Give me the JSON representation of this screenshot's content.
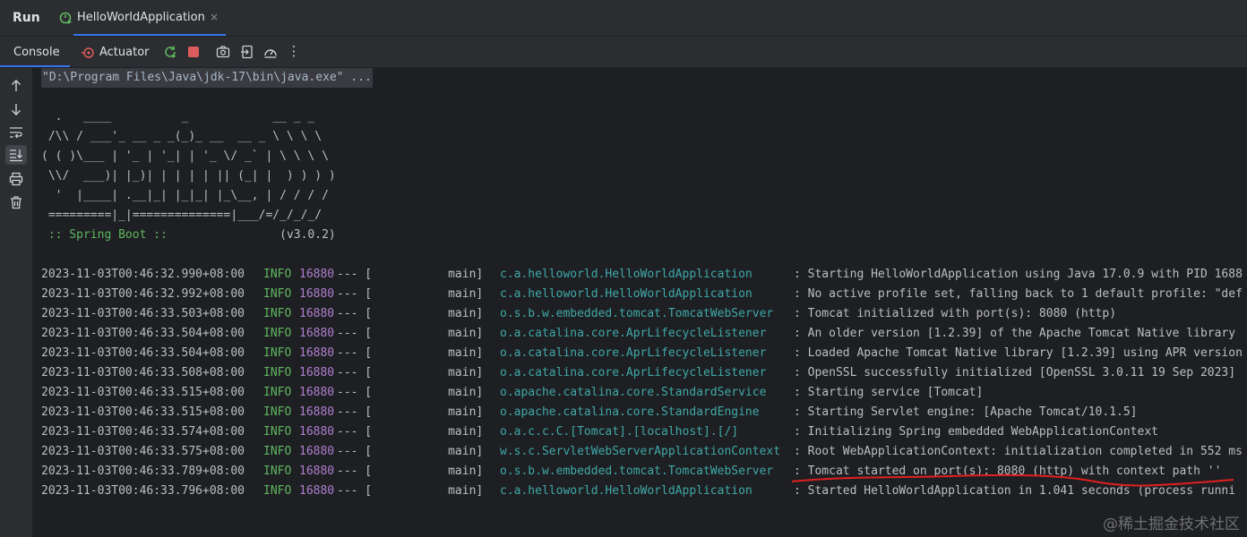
{
  "header": {
    "run_label": "Run",
    "tab_title": "HelloWorldApplication",
    "tab_close": "×"
  },
  "toolbar": {
    "console_label": "Console",
    "actuator_label": "Actuator",
    "more": "⋮"
  },
  "console": {
    "command": "\"D:\\Program Files\\Java\\jdk-17\\bin\\java.exe\" ...",
    "banner": "  .   ____          _            __ _ _\n /\\\\ / ___'_ __ _ _(_)_ __  __ _ \\ \\ \\ \\\n( ( )\\___ | '_ | '_| | '_ \\/ _` | \\ \\ \\ \\\n \\\\/  ___)| |_)| | | | | || (_| |  ) ) ) )\n  '  |____| .__|_| |_|_| |_\\__, | / / / /\n =========|_|==============|___/=/_/_/_/",
    "boot_label": " :: Spring Boot :: ",
    "boot_version": "               (v3.0.2)",
    "logs": [
      {
        "ts": "2023-11-03T00:46:32.990+08:00",
        "level": "INFO",
        "pid": "16880",
        "sep": "--- [",
        "thread": "           main]",
        "logger": "c.a.helloworld.HelloWorldApplication",
        "msg": ": Starting HelloWorldApplication using Java 17.0.9 with PID 1688"
      },
      {
        "ts": "2023-11-03T00:46:32.992+08:00",
        "level": "INFO",
        "pid": "16880",
        "sep": "--- [",
        "thread": "           main]",
        "logger": "c.a.helloworld.HelloWorldApplication",
        "msg": ": No active profile set, falling back to 1 default profile: \"def"
      },
      {
        "ts": "2023-11-03T00:46:33.503+08:00",
        "level": "INFO",
        "pid": "16880",
        "sep": "--- [",
        "thread": "           main]",
        "logger": "o.s.b.w.embedded.tomcat.TomcatWebServer",
        "msg": ": Tomcat initialized with port(s): 8080 (http)"
      },
      {
        "ts": "2023-11-03T00:46:33.504+08:00",
        "level": "INFO",
        "pid": "16880",
        "sep": "--- [",
        "thread": "           main]",
        "logger": "o.a.catalina.core.AprLifecycleListener",
        "msg": ": An older version [1.2.39] of the Apache Tomcat Native library"
      },
      {
        "ts": "2023-11-03T00:46:33.504+08:00",
        "level": "INFO",
        "pid": "16880",
        "sep": "--- [",
        "thread": "           main]",
        "logger": "o.a.catalina.core.AprLifecycleListener",
        "msg": ": Loaded Apache Tomcat Native library [1.2.39] using APR version"
      },
      {
        "ts": "2023-11-03T00:46:33.508+08:00",
        "level": "INFO",
        "pid": "16880",
        "sep": "--- [",
        "thread": "           main]",
        "logger": "o.a.catalina.core.AprLifecycleListener",
        "msg": ": OpenSSL successfully initialized [OpenSSL 3.0.11 19 Sep 2023]"
      },
      {
        "ts": "2023-11-03T00:46:33.515+08:00",
        "level": "INFO",
        "pid": "16880",
        "sep": "--- [",
        "thread": "           main]",
        "logger": "o.apache.catalina.core.StandardService",
        "msg": ": Starting service [Tomcat]"
      },
      {
        "ts": "2023-11-03T00:46:33.515+08:00",
        "level": "INFO",
        "pid": "16880",
        "sep": "--- [",
        "thread": "           main]",
        "logger": "o.apache.catalina.core.StandardEngine",
        "msg": ": Starting Servlet engine: [Apache Tomcat/10.1.5]"
      },
      {
        "ts": "2023-11-03T00:46:33.574+08:00",
        "level": "INFO",
        "pid": "16880",
        "sep": "--- [",
        "thread": "           main]",
        "logger": "o.a.c.c.C.[Tomcat].[localhost].[/]",
        "msg": ": Initializing Spring embedded WebApplicationContext"
      },
      {
        "ts": "2023-11-03T00:46:33.575+08:00",
        "level": "INFO",
        "pid": "16880",
        "sep": "--- [",
        "thread": "           main]",
        "logger": "w.s.c.ServletWebServerApplicationContext",
        "msg": ": Root WebApplicationContext: initialization completed in 552 ms"
      },
      {
        "ts": "2023-11-03T00:46:33.789+08:00",
        "level": "INFO",
        "pid": "16880",
        "sep": "--- [",
        "thread": "           main]",
        "logger": "o.s.b.w.embedded.tomcat.TomcatWebServer",
        "msg": ": Tomcat started on port(s): 8080 (http) with context path ''"
      },
      {
        "ts": "2023-11-03T00:46:33.796+08:00",
        "level": "INFO",
        "pid": "16880",
        "sep": "--- [",
        "thread": "           main]",
        "logger": "c.a.helloworld.HelloWorldApplication",
        "msg": ": Started HelloWorldApplication in 1.041 seconds (process runni"
      }
    ]
  },
  "watermark": "@稀土掘金技术社区",
  "colors": {
    "accent": "#3574f0",
    "level_info": "#5fb760",
    "pid": "#b07fd1",
    "logger": "#3fa8a8",
    "stop": "#db5c5c",
    "annotation": "#e02020"
  }
}
